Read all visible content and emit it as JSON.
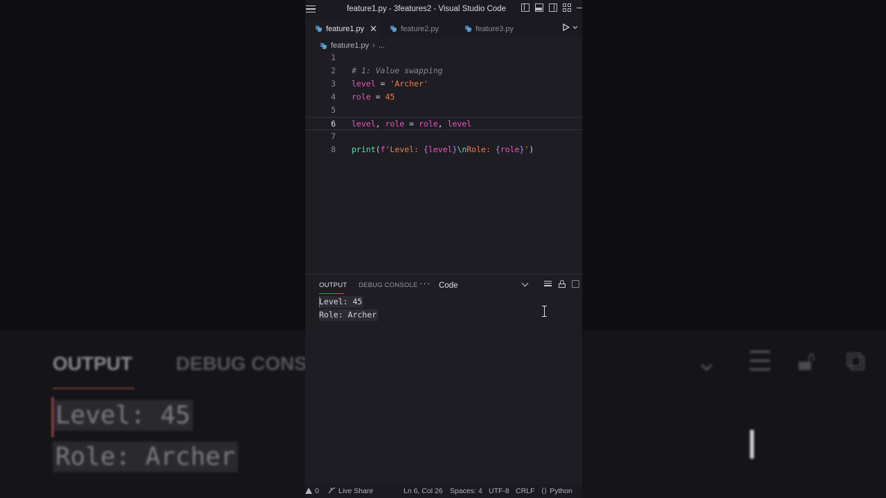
{
  "window": {
    "title": "feature1.py - 3features2 - Visual Studio Code"
  },
  "tabs": [
    {
      "label": "feature1.py",
      "active": true,
      "close": "✕"
    },
    {
      "label": "feature2.py",
      "active": false
    },
    {
      "label": "feature3.py",
      "active": false
    }
  ],
  "breadcrumb": {
    "file": "feature1.py",
    "sep": "›",
    "more": "..."
  },
  "editor": {
    "current_line": 6,
    "lines": [
      {
        "n": "1",
        "tokens": []
      },
      {
        "n": "2",
        "tokens": [
          {
            "t": "# 1: Value swapping",
            "c": "com"
          }
        ]
      },
      {
        "n": "3",
        "tokens": [
          {
            "t": "level",
            "c": "var"
          },
          {
            "t": " = ",
            "c": "op"
          },
          {
            "t": "'Archer'",
            "c": "str"
          }
        ]
      },
      {
        "n": "4",
        "tokens": [
          {
            "t": "role",
            "c": "var"
          },
          {
            "t": " = ",
            "c": "op"
          },
          {
            "t": "45",
            "c": "num"
          }
        ]
      },
      {
        "n": "5",
        "tokens": []
      },
      {
        "n": "6",
        "tokens": [
          {
            "t": "level",
            "c": "var"
          },
          {
            "t": ", ",
            "c": "op"
          },
          {
            "t": "role",
            "c": "var"
          },
          {
            "t": " = ",
            "c": "op"
          },
          {
            "t": "role",
            "c": "var"
          },
          {
            "t": ", ",
            "c": "op"
          },
          {
            "t": "level",
            "c": "var"
          }
        ]
      },
      {
        "n": "7",
        "tokens": []
      },
      {
        "n": "8",
        "tokens": [
          {
            "t": "print",
            "c": "fn"
          },
          {
            "t": "(",
            "c": "op"
          },
          {
            "t": "f",
            "c": "f"
          },
          {
            "t": "'Level: ",
            "c": "str"
          },
          {
            "t": "{",
            "c": "brace"
          },
          {
            "t": "level",
            "c": "var"
          },
          {
            "t": "}",
            "c": "brace"
          },
          {
            "t": "\\n",
            "c": "esc"
          },
          {
            "t": "Role: ",
            "c": "str"
          },
          {
            "t": "{",
            "c": "brace"
          },
          {
            "t": "role",
            "c": "var"
          },
          {
            "t": "}",
            "c": "brace"
          },
          {
            "t": "'",
            "c": "str"
          },
          {
            "t": ")",
            "c": "op"
          }
        ]
      }
    ]
  },
  "panel": {
    "tabs": {
      "output": "OUTPUT",
      "debug": "DEBUG CONSOLE"
    },
    "more": "···",
    "channel": "Code",
    "output_lines": [
      "Level: 45",
      "Role: Archer"
    ]
  },
  "status": {
    "problems": "0",
    "live_share": "Live Share",
    "cursor": "Ln 6, Col 26",
    "spaces": "Spaces: 4",
    "encoding": "UTF-8",
    "eol": "CRLF",
    "language": "Python"
  },
  "background": {
    "output": "OUTPUT",
    "debug": "DEBUG CONSO",
    "line1": "Level: 45",
    "line2": "Role: Archer"
  },
  "colors": {
    "keyword_var": "#ee55c4",
    "string": "#f07f4f",
    "function": "#5ce3b3",
    "accent_underline": "#d05050"
  }
}
